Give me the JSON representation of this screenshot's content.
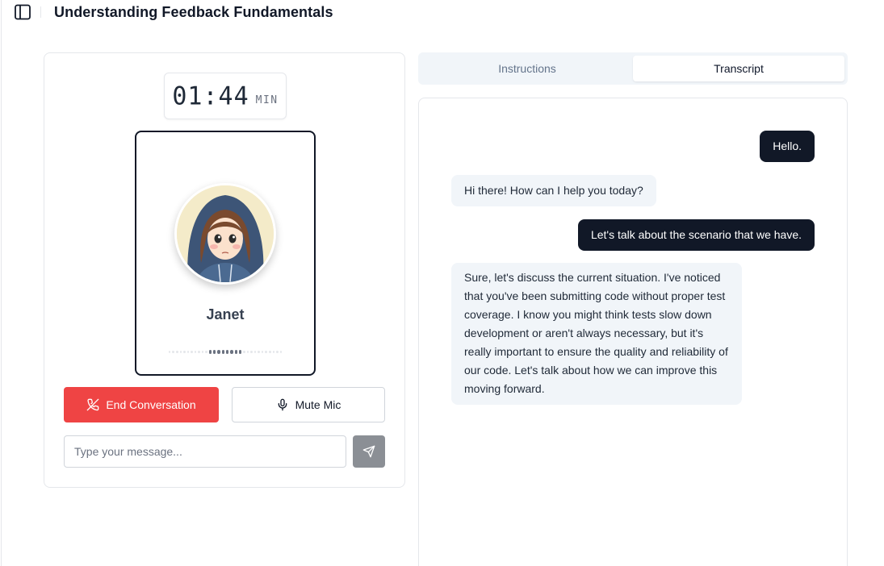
{
  "header": {
    "title": "Understanding Feedback Fundamentals"
  },
  "call": {
    "timer_value": "01:44",
    "timer_unit": "MIN",
    "persona_name": "Janet",
    "end_label": "End Conversation",
    "mute_label": "Mute Mic",
    "input_placeholder": "Type your message..."
  },
  "tabs": {
    "instructions": "Instructions",
    "transcript": "Transcript",
    "active": "transcript"
  },
  "messages": [
    {
      "role": "user",
      "text": "Hello."
    },
    {
      "role": "assistant",
      "text": "Hi there! How can I help you today?"
    },
    {
      "role": "user",
      "text": "Let's talk about the scenario that we have."
    },
    {
      "role": "assistant",
      "text": "Sure, let's discuss the current situation. I've noticed that you've been submitting code without proper test coverage. I know you might think tests slow down development or aren't always necessary, but it's really important to ensure the quality and reliability of our code. Let's talk about how we can improve this moving forward."
    }
  ],
  "colors": {
    "end_button": "#ef4444",
    "user_bubble": "#111827",
    "bot_bubble": "#f1f5f9",
    "send_button": "#8b8f95"
  },
  "icons": {
    "sidebar": "panel-left-icon",
    "end": "phone-off-icon",
    "mute": "mic-icon",
    "send": "send-icon"
  }
}
